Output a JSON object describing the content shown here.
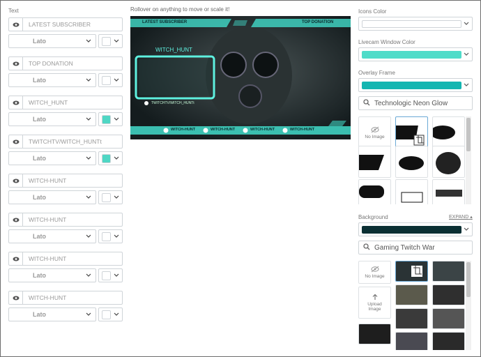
{
  "left": {
    "section_label": "Text",
    "rows": [
      {
        "text": "LATEST SUBSCRIBER",
        "font": "Lato",
        "color": "#ffffff"
      },
      {
        "text": "TOP DONATION",
        "font": "Lato",
        "color": "#ffffff"
      },
      {
        "text": "WITCH_HUNT",
        "font": "Lato",
        "color": "#4fd7c4"
      },
      {
        "text": "TWITCHTV/WITCH_HUNTt",
        "font": "Lato",
        "color": "#4fd7c4"
      },
      {
        "text": "WITCH-HUNT",
        "font": "Lato",
        "color": "#ffffff"
      },
      {
        "text": "WITCH-HUNT",
        "font": "Lato",
        "color": "#ffffff"
      },
      {
        "text": "WITCH-HUNT",
        "font": "Lato",
        "color": "#ffffff"
      },
      {
        "text": "WITCH-HUNT",
        "font": "Lato",
        "color": "#ffffff"
      }
    ]
  },
  "preview": {
    "hint": "Rollover on anything to move or scale it!",
    "latest_subscriber": "LATEST SUBSCRIBER",
    "top_donation": "TOP DONATION",
    "name": "WITCH_HUNT",
    "url": "TWITCHTV/WITCH_HUNTt",
    "socials": [
      "WITCH-HUNT",
      "WITCH-HUNT",
      "WITCH-HUNT",
      "WITCH-HUNT"
    ],
    "accent": "#3fd0c0"
  },
  "right": {
    "icons_color_label": "Icons Color",
    "icons_color": "#ffffff",
    "livecam_label": "Livecam Window Color",
    "livecam_color": "#4fdcc9",
    "overlay_frame_label": "Overlay Frame",
    "overlay_frame_color": "#13b6b1",
    "frame_search": "Technologic Neon Glow",
    "no_image": "No Image",
    "background_label": "Background",
    "expand_label": "EXPAND",
    "background_color": "#0a2f33",
    "bg_search": "Gaming Twitch War",
    "upload_image": "Upload Image"
  }
}
